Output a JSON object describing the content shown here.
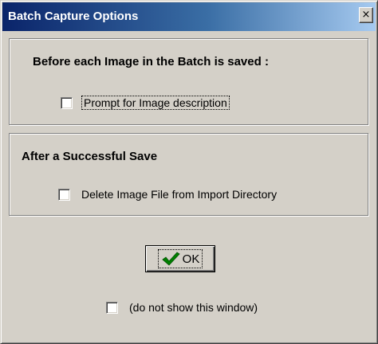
{
  "window": {
    "title": "Batch Capture Options",
    "close_glyph": "×"
  },
  "before_save": {
    "heading": "Before each Image in the Batch is saved :",
    "option_label": "Prompt for Image description",
    "checked": false
  },
  "after_save": {
    "heading": "After a Successful Save",
    "option_label": "Delete Image File from Import Directory",
    "checked": false
  },
  "ok_button": {
    "label": "OK",
    "icon": "checkmark-icon",
    "icon_color": "#008000"
  },
  "dont_show": {
    "label": "(do not show this window)",
    "checked": false
  }
}
